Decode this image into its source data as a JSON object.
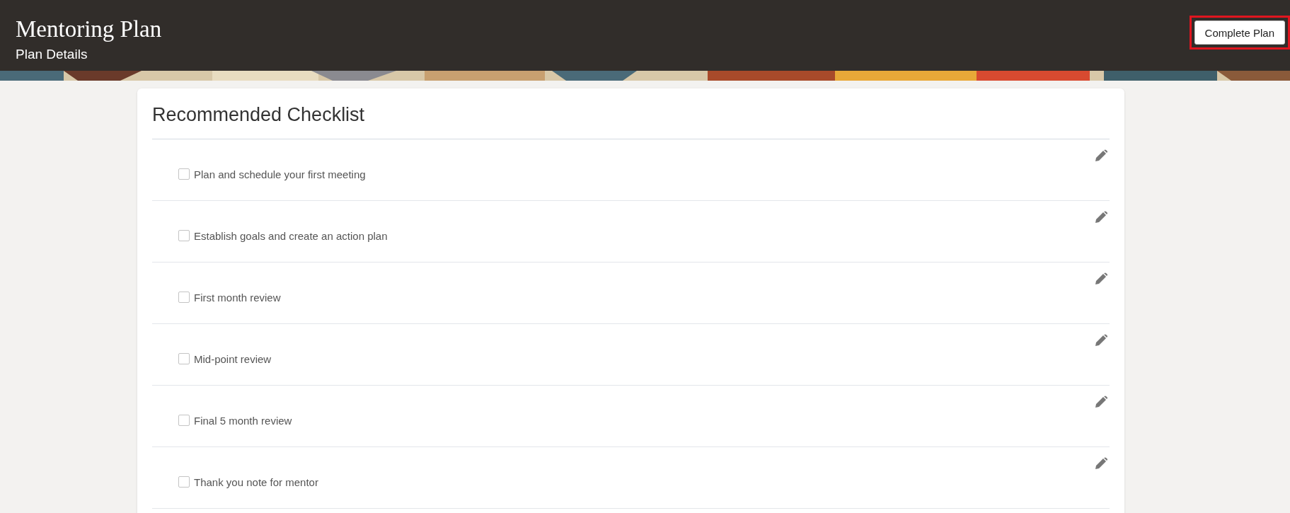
{
  "header": {
    "title": "Mentoring Plan",
    "subtitle": "Plan Details",
    "action": {
      "label": "Complete Plan",
      "highlighted": true
    }
  },
  "checklist": {
    "title": "Recommended Checklist",
    "items": [
      {
        "label": "Plan and schedule your first meeting",
        "checked": false
      },
      {
        "label": "Establish goals and create an action plan",
        "checked": false
      },
      {
        "label": "First month review",
        "checked": false
      },
      {
        "label": "Mid-point review",
        "checked": false
      },
      {
        "label": "Final 5 month review",
        "checked": false
      },
      {
        "label": "Thank you note for mentor",
        "checked": false
      }
    ]
  }
}
